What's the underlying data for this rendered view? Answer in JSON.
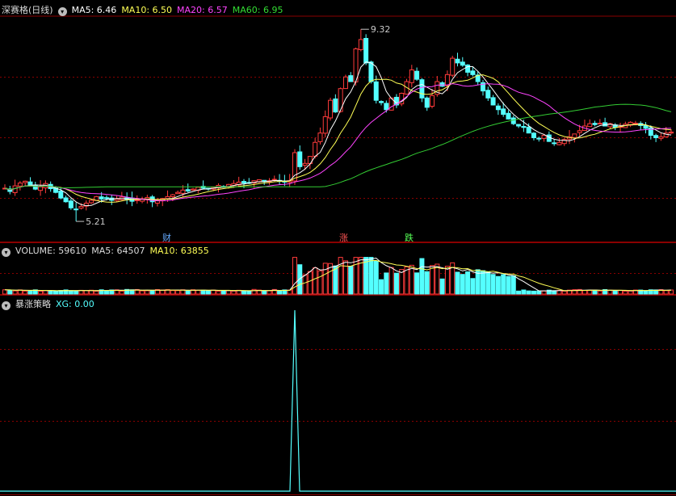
{
  "colors": {
    "up": "#ff3b3b",
    "down": "#54ffff",
    "grid": "#8a0000",
    "ma5": "#ffffff",
    "ma10": "#ffff55",
    "ma20": "#ff44ff",
    "ma60": "#33cc33",
    "xg": "#54ffff"
  },
  "price_panel": {
    "title": "深赛格(日线)",
    "ma5_label": "MA5: 6.46",
    "ma10_label": "MA10: 6.50",
    "ma20_label": "MA20: 6.57",
    "ma60_label": "MA60: 6.95",
    "high_label": "9.32",
    "low_label": "5.21",
    "tags": [
      {
        "text": "财",
        "color": "#66aaff"
      },
      {
        "text": "涨",
        "color": "#ff5555"
      },
      {
        "text": "跌",
        "color": "#55ff55"
      }
    ]
  },
  "volume_panel": {
    "vol_label": "VOLUME: 59610",
    "ma5_label": "MA5: 64507",
    "ma10_label": "MA10: 63855"
  },
  "indicator_panel": {
    "title": "暴涨策略",
    "xg_label": "XG: 0.00"
  },
  "chart_data": {
    "type": "candlestick",
    "price_ylim": [
      4.9,
      9.6
    ],
    "closes": [
      5.92,
      5.85,
      5.97,
      6.03,
      6.07,
      5.98,
      5.9,
      5.95,
      6.02,
      5.91,
      5.83,
      5.71,
      5.63,
      5.5,
      5.47,
      5.53,
      5.6,
      5.66,
      5.74,
      5.69,
      5.71,
      5.66,
      5.69,
      5.73,
      5.68,
      5.64,
      5.67,
      5.69,
      5.72,
      5.63,
      5.66,
      5.7,
      5.74,
      5.78,
      5.83,
      5.88,
      5.86,
      5.9,
      5.94,
      5.92,
      5.9,
      5.94,
      5.98,
      5.95,
      6.0,
      6.02,
      6.05,
      6.03,
      6.04,
      6.08,
      6.1,
      6.06,
      6.08,
      6.11,
      6.07,
      6.05,
      6.08,
      6.68,
      6.38,
      6.45,
      6.6,
      6.9,
      7.1,
      7.45,
      7.8,
      7.55,
      8.05,
      8.3,
      8.2,
      8.9,
      9.1,
      8.6,
      8.2,
      7.8,
      7.75,
      7.6,
      7.85,
      7.7,
      7.95,
      8.2,
      8.45,
      8.25,
      7.85,
      7.65,
      7.9,
      8.2,
      8.1,
      8.35,
      8.7,
      8.6,
      8.55,
      8.4,
      8.35,
      8.2,
      8.0,
      7.85,
      7.7,
      7.6,
      7.5,
      7.4,
      7.3,
      7.25,
      7.22,
      7.1,
      7.0,
      6.98,
      7.05,
      6.92,
      6.88,
      6.9,
      6.96,
      7.02,
      7.08,
      7.15,
      7.25,
      7.3,
      7.28,
      7.31,
      7.25,
      7.3,
      7.22,
      7.24,
      7.29,
      7.33,
      7.31,
      7.26,
      7.2,
      7.05,
      7.0,
      7.02,
      7.1,
      7.12
    ],
    "volume_ylim": [
      0,
      400000
    ],
    "xg_ylim": [
      0,
      1
    ],
    "xg_spike_index": 57
  }
}
